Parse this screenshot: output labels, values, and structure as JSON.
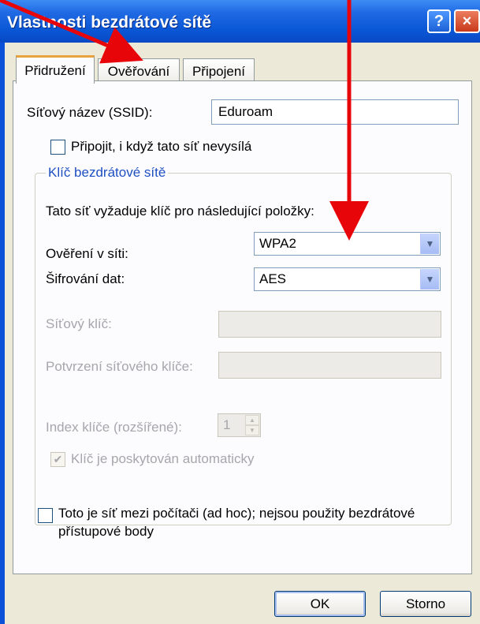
{
  "window": {
    "title": "Vlastnosti bezdrátové sítě",
    "help_glyph": "?",
    "close_glyph": "×"
  },
  "tabs": [
    {
      "label": "Přidružení",
      "active": true
    },
    {
      "label": "Ověřování",
      "active": false
    },
    {
      "label": "Připojení",
      "active": false
    }
  ],
  "ssid": {
    "label": "Síťový název (SSID):",
    "value": "Eduroam"
  },
  "connect_hidden": {
    "label": "Připojit, i když tato síť nevysílá",
    "checked": false
  },
  "key_group": {
    "title": "Klíč bezdrátové sítě",
    "intro": "Tato síť vyžaduje klíč pro následující položky:",
    "auth": {
      "label": "Ověření v síti:",
      "value": "WPA2"
    },
    "encryption": {
      "label": "Šifrování dat:",
      "value": "AES"
    },
    "network_key": {
      "label": "Síťový klíč:",
      "value": ""
    },
    "confirm_key": {
      "label": "Potvrzení síťového klíče:",
      "value": ""
    },
    "key_index": {
      "label": "Index klíče (rozšířené):",
      "value": "1"
    },
    "auto_key": {
      "label": "Klíč je poskytován automaticky",
      "checked": true
    }
  },
  "adhoc": {
    "line1": "Toto je síť mezi počítači (ad hoc); nejsou použity bezdrátové",
    "line2": "přístupové body",
    "checked": false
  },
  "buttons": {
    "ok": "OK",
    "cancel": "Storno"
  },
  "annotation": {
    "arrow_color": "#e8050a"
  }
}
